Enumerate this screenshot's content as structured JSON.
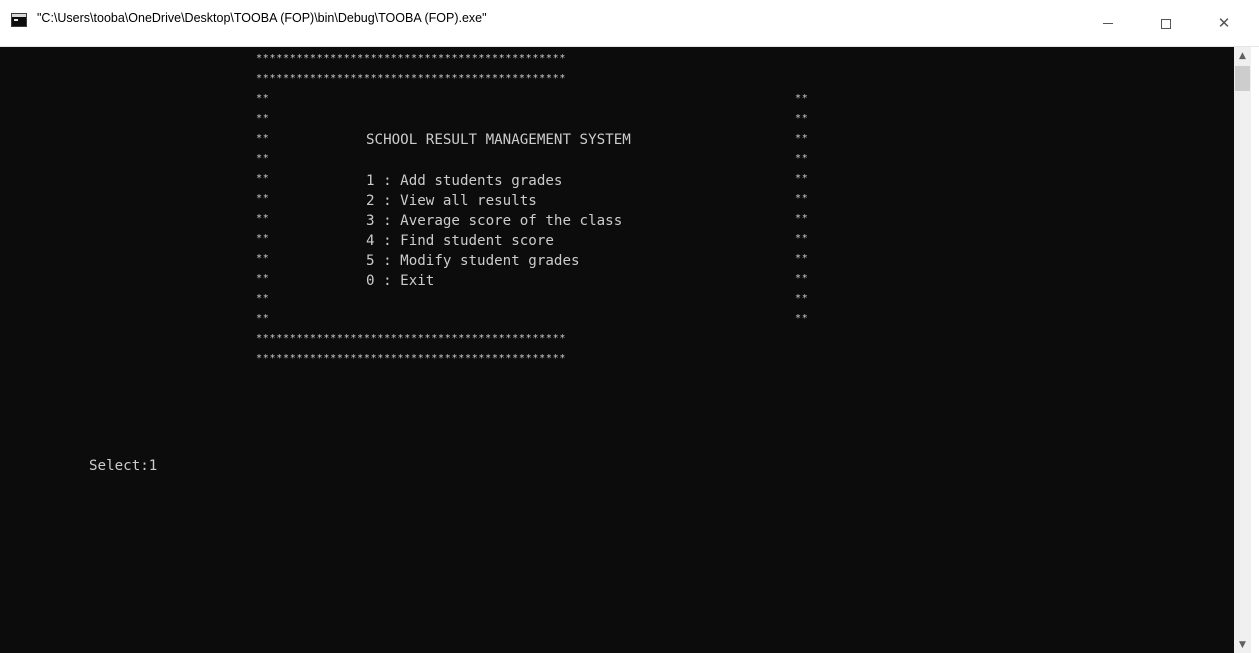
{
  "window": {
    "title": "\"C:\\Users\\tooba\\OneDrive\\Desktop\\TOOBA (FOP)\\bin\\Debug\\TOOBA (FOP).exe\"",
    "close_glyph": "✕",
    "scroll_up_glyph": "▲",
    "scroll_down_glyph": "▼"
  },
  "console": {
    "border_full": "**********************************************",
    "border_side": "**",
    "heading": "SCHOOL RESULT MANAGEMENT SYSTEM",
    "menu": [
      "1 : Add students grades",
      "2 : View all results",
      "3 : Average score of the class",
      "4 : Find student score",
      "5 : Modify student grades",
      "0 : Exit"
    ],
    "prompt": "Select:1"
  },
  "colors": {
    "console_bg": "#0c0c0c",
    "console_text": "#cccccc",
    "titlebar_bg": "#ffffff"
  },
  "icons": [
    "console-app-icon",
    "minimize-icon",
    "maximize-icon",
    "close-icon",
    "scroll-up-icon",
    "scroll-down-icon"
  ]
}
